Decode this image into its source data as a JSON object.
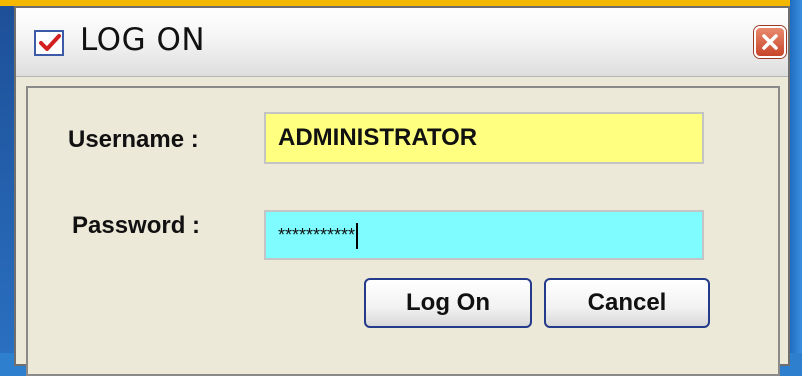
{
  "window": {
    "title": "LOG ON",
    "icons": {
      "app": "checkbox-check-icon",
      "close": "close-icon"
    }
  },
  "form": {
    "username_label": "Username :",
    "username_value": "ADMINISTRATOR",
    "password_label": "Password :",
    "password_masked": "***********"
  },
  "buttons": {
    "logon_label": "Log On",
    "cancel_label": "Cancel"
  },
  "colors": {
    "username_bg": "#ffff80",
    "password_bg": "#7efcff",
    "desktop": "#2f7fcf"
  }
}
